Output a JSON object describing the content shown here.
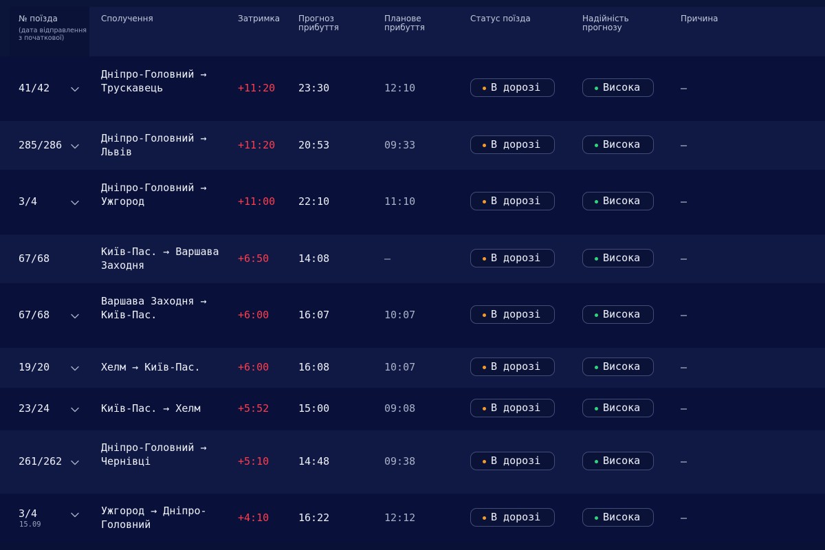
{
  "header": {
    "train_no": "№ поїзда",
    "train_no_sub": "(дата відправлення з початкової)",
    "route": "Сполучення",
    "delay": "Затримка",
    "forecast_arrival": "Прогноз прибуття",
    "planned_arrival": "Планове прибуття",
    "train_status": "Статус поїзда",
    "forecast_reliability": "Надійність прогнозу",
    "reason": "Причина"
  },
  "rows": [
    {
      "train": "41/42",
      "date": "",
      "route": "Дніпро-Головний → Трускавець",
      "delay": "+11:20",
      "forecast": "23:30",
      "planned": "12:10",
      "status": "В дорозі",
      "reliability": "Висока",
      "reason": "—",
      "expandable": true
    },
    {
      "train": "285/286",
      "date": "",
      "route": "Дніпро-Головний → Львів",
      "delay": "+11:20",
      "forecast": "20:53",
      "planned": "09:33",
      "status": "В дорозі",
      "reliability": "Висока",
      "reason": "—",
      "expandable": true
    },
    {
      "train": "3/4",
      "date": "",
      "route": "Дніпро-Головний → Ужгород",
      "delay": "+11:00",
      "forecast": "22:10",
      "planned": "11:10",
      "status": "В дорозі",
      "reliability": "Висока",
      "reason": "—",
      "expandable": true
    },
    {
      "train": "67/68",
      "date": "",
      "route": "Київ-Пас. → Варшава Заходня",
      "delay": "+6:50",
      "forecast": "14:08",
      "planned": "—",
      "status": "В дорозі",
      "reliability": "Висока",
      "reason": "—",
      "expandable": false
    },
    {
      "train": "67/68",
      "date": "",
      "route": "Варшава Заходня → Київ-Пас.",
      "delay": "+6:00",
      "forecast": "16:07",
      "planned": "10:07",
      "status": "В дорозі",
      "reliability": "Висока",
      "reason": "—",
      "expandable": true
    },
    {
      "train": "19/20",
      "date": "",
      "route": "Хелм → Київ-Пас.",
      "delay": "+6:00",
      "forecast": "16:08",
      "planned": "10:07",
      "status": "В дорозі",
      "reliability": "Висока",
      "reason": "—",
      "expandable": true
    },
    {
      "train": "23/24",
      "date": "",
      "route": "Київ-Пас. → Хелм",
      "delay": "+5:52",
      "forecast": "15:00",
      "planned": "09:08",
      "status": "В дорозі",
      "reliability": "Висока",
      "reason": "—",
      "expandable": true
    },
    {
      "train": "261/262",
      "date": "",
      "route": "Дніпро-Головний → Чернівці",
      "delay": "+5:10",
      "forecast": "14:48",
      "planned": "09:38",
      "status": "В дорозі",
      "reliability": "Висока",
      "reason": "—",
      "expandable": true
    },
    {
      "train": "3/4",
      "date": "15.09",
      "route": "Ужгород → Дніпро-Головний",
      "delay": "+4:10",
      "forecast": "16:22",
      "planned": "12:12",
      "status": "В дорозі",
      "reliability": "Висока",
      "reason": "—",
      "expandable": true
    }
  ],
  "colors": {
    "delay": "#ff3d4f",
    "status_dot": "#f59c2b",
    "reliability_dot": "#2fd67a"
  }
}
